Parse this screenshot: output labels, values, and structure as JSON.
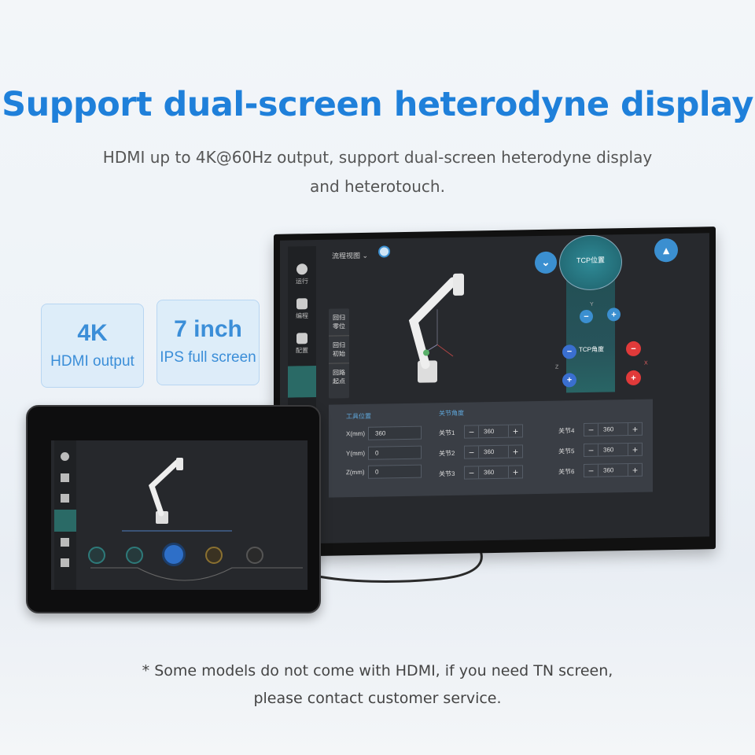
{
  "header": {
    "title": "Support dual-screen heterodyne display",
    "subtitle_line1": "HDMI up to 4K@60Hz output, support dual-screen heterodyne display",
    "subtitle_line2": "and heterotouch."
  },
  "badges": [
    {
      "value": "4K",
      "label": "HDMI output"
    },
    {
      "value": "7 inch",
      "label": "IPS full screen"
    }
  ],
  "monitor_ui": {
    "sidebar": [
      "运行",
      "编程",
      "配置"
    ],
    "view_dropdown": "流程视图",
    "quick_menu": [
      "回归零位",
      "回归初始",
      "回路起点"
    ],
    "tcp_position_label": "TCP位置",
    "tcp_angle_label": "TCP角度",
    "axes": {
      "x": "X",
      "y": "Y",
      "z": "Z"
    },
    "tool_position": {
      "title": "工具位置",
      "fields": [
        {
          "label": "X(mm)",
          "value": "360"
        },
        {
          "label": "Y(mm)",
          "value": "0"
        },
        {
          "label": "Z(mm)",
          "value": "0"
        }
      ]
    },
    "joint_angles": {
      "title": "关节角度",
      "joints": [
        {
          "label": "关节1",
          "value": "360"
        },
        {
          "label": "关节2",
          "value": "360"
        },
        {
          "label": "关节3",
          "value": "360"
        },
        {
          "label": "关节4",
          "value": "360"
        },
        {
          "label": "关节5",
          "value": "360"
        },
        {
          "label": "关节6",
          "value": "360"
        }
      ]
    },
    "minus": "−",
    "plus": "+"
  },
  "colors": {
    "accent": "#1f80da",
    "blue_button": "#3b8fd0",
    "red_button": "#e03a3a",
    "teal": "#2a8c8a"
  },
  "footer": {
    "line1": "* Some models do not come with HDMI, if you need TN screen,",
    "line2": "please contact customer service."
  }
}
